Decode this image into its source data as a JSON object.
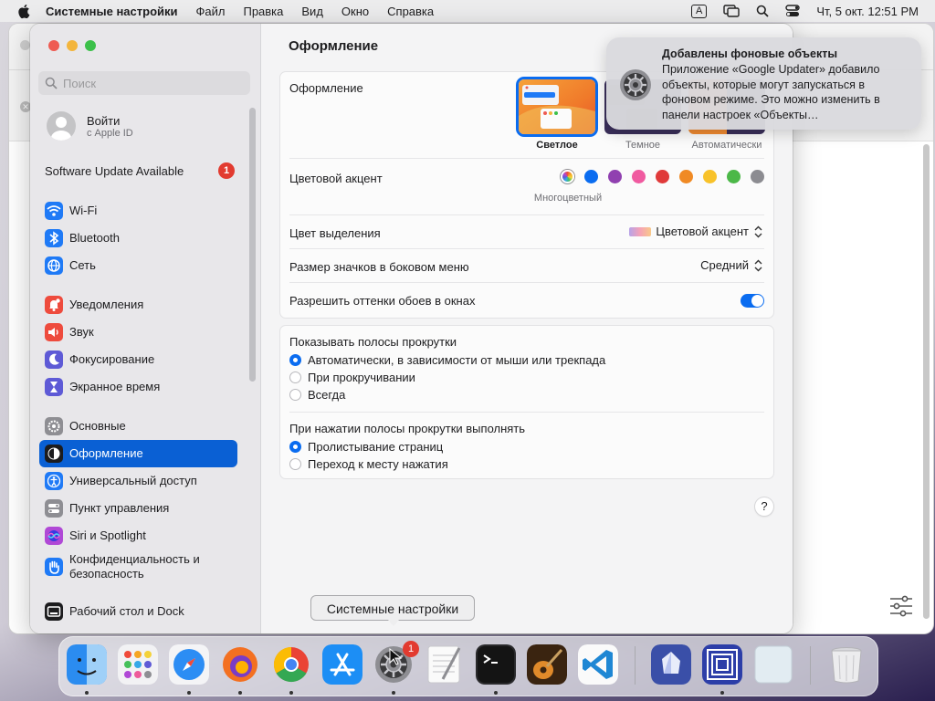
{
  "menubar": {
    "app_name": "Системные настройки",
    "items": [
      "Файл",
      "Правка",
      "Вид",
      "Окно",
      "Справка"
    ],
    "input_indicator": "A",
    "clock": "Чт, 5 окт.  12:51 PM"
  },
  "sidebar": {
    "search_placeholder": "Поиск",
    "apple_id": {
      "name": "Войти",
      "sub": "с Apple ID"
    },
    "software_update": {
      "label": "Software Update Available",
      "badge": "1"
    },
    "items": [
      {
        "label": "Wi-Fi",
        "icon": "wifi-icon",
        "color": "#1f7af6"
      },
      {
        "label": "Bluetooth",
        "icon": "bluetooth-icon",
        "color": "#1f7af6"
      },
      {
        "label": "Сеть",
        "icon": "globe-icon",
        "color": "#1f7af6"
      },
      {
        "label": "Уведомления",
        "icon": "bell-icon",
        "color": "#ee4b3d"
      },
      {
        "label": "Звук",
        "icon": "speaker-icon",
        "color": "#ee4b3d"
      },
      {
        "label": "Фокусирование",
        "icon": "moon-icon",
        "color": "#5e5ad6"
      },
      {
        "label": "Экранное время",
        "icon": "hourglass-icon",
        "color": "#5e5ad6"
      },
      {
        "label": "Основные",
        "icon": "gear-icon",
        "color": "#8e8e93"
      },
      {
        "label": "Оформление",
        "icon": "appearance-icon",
        "color": "#1c1c1e"
      },
      {
        "label": "Универсальный доступ",
        "icon": "accessibility-icon",
        "color": "#1f7af6"
      },
      {
        "label": "Пункт управления",
        "icon": "control-center-icon",
        "color": "#8e8e93"
      },
      {
        "label": "Siri и Spotlight",
        "icon": "siri-icon",
        "color": "#b048d6"
      },
      {
        "label": "Конфиденциальность и безопасность",
        "icon": "hand-icon",
        "color": "#1f7af6"
      },
      {
        "label": "Рабочий стол и Dock",
        "icon": "dock-icon",
        "color": "#1c1c1e"
      }
    ]
  },
  "content": {
    "title": "Оформление",
    "appearance": {
      "label": "Оформление",
      "options": [
        "Светлое",
        "Темное",
        "Автоматически"
      ],
      "selected": "Светлое"
    },
    "accent": {
      "label": "Цветовой акцент",
      "selected_name": "Многоцветный",
      "colors": [
        "#8e8e93",
        "#0a6cf0",
        "#9040b0",
        "#f05aa0",
        "#e03a3a",
        "#f08a24",
        "#f8c22a",
        "#4cb848",
        "#8c8c91"
      ]
    },
    "highlight": {
      "label": "Цвет выделения",
      "value": "Цветовой акцент"
    },
    "sidebar_icon_size": {
      "label": "Размер значков в боковом меню",
      "value": "Средний"
    },
    "wallpaper_tint": {
      "label": "Разрешить оттенки обоев в окнах"
    },
    "scrollbars": {
      "label": "Показывать полосы прокрутки",
      "options": [
        "Автоматически, в зависимости от мыши или трекпада",
        "При прокручивании",
        "Всегда"
      ]
    },
    "click_scroll": {
      "label": "При нажатии полосы прокрутки выполнять",
      "options": [
        "Пролистывание страниц",
        "Переход к месту нажатия"
      ]
    },
    "help": "?"
  },
  "notification": {
    "title": "Добавлены фоновые объекты",
    "body": "Приложение «Google Updater» добавило объекты, которые могут запускаться в фоновом режиме. Это можно изменить в панели настроек «Объекты…"
  },
  "tooltip": "Системные настройки",
  "dock": {
    "settings_badge": "1",
    "apps": [
      "finder-icon",
      "launchpad-icon",
      "safari-icon",
      "firefox-icon",
      "chrome-icon",
      "app-store-icon",
      "system-settings-icon",
      "textedit-icon",
      "terminal-icon",
      "garageband-icon",
      "vscode-icon",
      "app-icon",
      "window-icon",
      "blank-icon",
      "trash-icon"
    ]
  }
}
